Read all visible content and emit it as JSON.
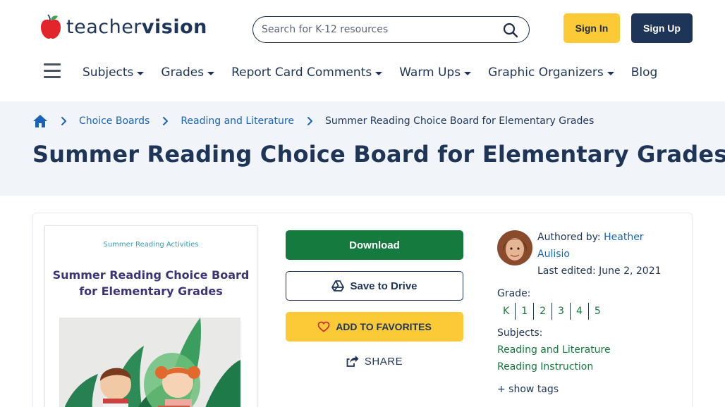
{
  "header": {
    "logo": {
      "text_light": "teacher",
      "text_bold": "vision"
    },
    "search": {
      "placeholder": "Search for K-12 resources"
    },
    "sign_in_label": "Sign In",
    "sign_up_label": "Sign Up"
  },
  "nav": {
    "items": [
      {
        "label": "Subjects",
        "has_dropdown": true
      },
      {
        "label": "Grades",
        "has_dropdown": true
      },
      {
        "label": "Report Card Comments",
        "has_dropdown": true
      },
      {
        "label": "Warm Ups",
        "has_dropdown": true
      },
      {
        "label": "Graphic Organizers",
        "has_dropdown": true
      },
      {
        "label": "Blog",
        "has_dropdown": false
      }
    ]
  },
  "breadcrumb": {
    "items": [
      "Choice Boards",
      "Reading and Literature"
    ],
    "current": "Summer Reading Choice Board for Elementary Grades"
  },
  "page_title": "Summer Reading Choice Board for Elementary Grades",
  "resource": {
    "thumbnail": {
      "subtitle": "Summer Reading Activities",
      "title_line1": "Summer Reading Choice Board",
      "title_line2": "for Elementary Grades"
    },
    "actions": {
      "download_label": "Download",
      "drive_label": "Save to Drive",
      "favorites_label": "ADD TO FAVORITES",
      "share_label": "SHARE"
    },
    "meta": {
      "authored_by_label": "Authored by:",
      "author_first": "Heather",
      "author_last": "Aulisio",
      "last_edited": "Last edited: June 2, 2021",
      "grade_label": "Grade:",
      "grades": [
        "K",
        "1",
        "2",
        "3",
        "4",
        "5"
      ],
      "subjects_label": "Subjects:",
      "subjects": [
        "Reading and Literature",
        "Reading Instruction"
      ],
      "show_tags_label": "+ show tags"
    }
  },
  "colors": {
    "navy": "#1e3558",
    "yellow": "#fcc937",
    "green": "#157a3e",
    "link_blue": "#1b63b4",
    "band_bg": "#f1f4f9",
    "apple_red": "#e2252b"
  }
}
